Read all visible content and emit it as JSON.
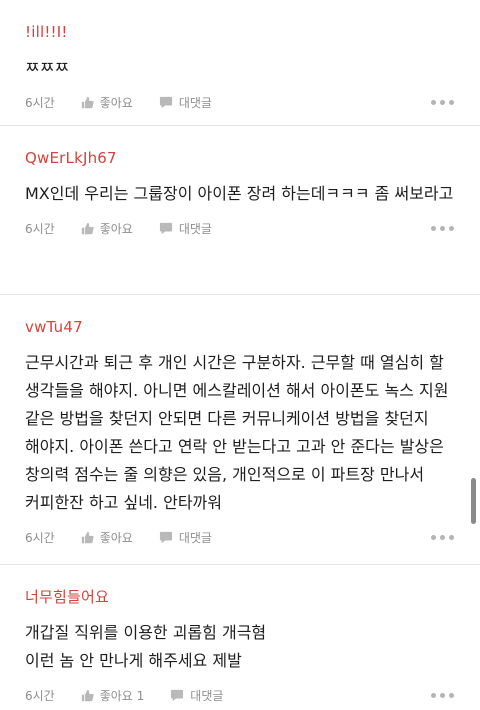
{
  "comments": [
    {
      "username": "!ill!!I!",
      "body": "ㅉㅉㅉ",
      "time": "6시간",
      "like_label": "좋아요",
      "reply_label": "대댓글"
    },
    {
      "username": "QwErLkJh67",
      "body": "MX인데 우리는 그룹장이 아이폰 장려 하는데ㅋㅋㅋ 좀 써보라고",
      "time": "6시간",
      "like_label": "좋아요",
      "reply_label": "대댓글"
    },
    {
      "username": "vwTu47",
      "body": "근무시간과 퇴근 후 개인 시간은 구분하자. 근무할 때 열심히 할 생각들을 해야지. 아니면 에스칼레이션 해서 아이폰도 녹스 지원 같은 방법을 찾던지 안되면 다른 커뮤니케이션 방법을 찾던지 해야지. 아이폰 쓴다고 연락 안 받는다고 고과 안 준다는 발상은 창의력 점수는 줄 의향은 있음, 개인적으로 이 파트장 만나서 커피한잔 하고 싶네. 안타까워",
      "time": "6시간",
      "like_label": "좋아요",
      "reply_label": "대댓글"
    },
    {
      "username": "너무힘들어요",
      "body_lines": [
        "개갑질 직위를 이용한 괴롭힘 개극혐",
        "이런 놈 안 만나게 해주세요 제발"
      ],
      "time": "6시간",
      "like_label": "좋아요 1",
      "reply_label": "대댓글"
    }
  ],
  "colors": {
    "username": "#d8423a",
    "body_text": "#1e1e1e",
    "meta_text": "#8e8e8e"
  },
  "icons": [
    "thumbs-up-icon",
    "speech-bubble-icon",
    "more-dots-icon"
  ]
}
